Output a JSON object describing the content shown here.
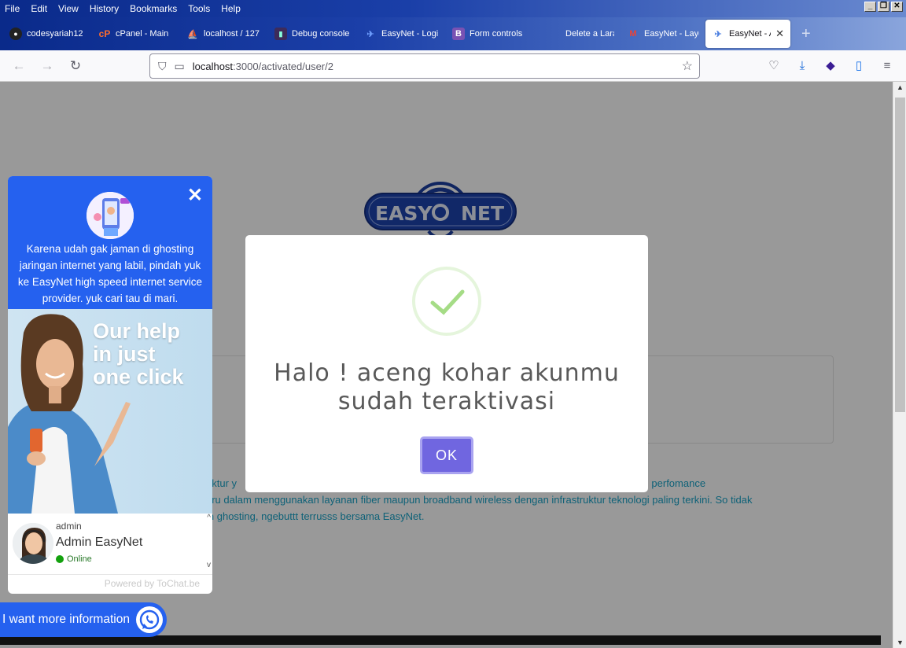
{
  "menubar": {
    "items": [
      "File",
      "Edit",
      "View",
      "History",
      "Bookmarks",
      "Tools",
      "Help"
    ]
  },
  "tabs": [
    {
      "label": "codesyariah12",
      "icon": "github-icon",
      "active": false
    },
    {
      "label": "cPanel - Main",
      "icon": "cpanel-icon",
      "active": false
    },
    {
      "label": "localhost / 127",
      "icon": "phpmyadmin-icon",
      "active": false
    },
    {
      "label": "Debug console",
      "icon": "debug-icon",
      "active": false
    },
    {
      "label": "EasyNet - Logi",
      "icon": "vue-icon",
      "active": false
    },
    {
      "label": "Form controls",
      "icon": "bootstrap-icon",
      "active": false
    },
    {
      "label": "Delete a Larav",
      "icon": "blank-icon",
      "active": false
    },
    {
      "label": "EasyNet - Layo",
      "icon": "mail-icon",
      "active": false
    },
    {
      "label": "EasyNet - A",
      "icon": "vue-icon",
      "active": true
    }
  ],
  "address": {
    "host": "localhost",
    "path": ":3000/activated/user/2"
  },
  "page": {
    "logo_left": "EASY",
    "logo_right": "NET",
    "body_text_1": "uktur y                                                                                                           n layanan EasyNet high perfomance",
    "body_text_2": "aru dalam menggunakan layanan fiber maupun broadband wireless dengan infrastruktur teknologi paling terkini.  So tidak",
    "body_text_3": "in ghosting, ngebuttt terrusss bersama EasyNet."
  },
  "modal": {
    "title": "Halo ! aceng kohar akunmu sudah teraktivasi",
    "ok_label": "OK",
    "success_color": "#a5dc86"
  },
  "chat": {
    "description": "Karena udah gak jaman di ghosting jaringan internet yang labil, pindah yuk ke EasyNet high speed internet service provider. yuk cari tau di mari.",
    "banner_line1": "Our help",
    "banner_line2": "in just",
    "banner_line3": "one click",
    "agent_role": "admin",
    "agent_name": "Admin EasyNet",
    "agent_status": "Online",
    "powered_by": "Powered by ToChat.be",
    "cta": "I want more information",
    "accent": "#2561ef"
  }
}
